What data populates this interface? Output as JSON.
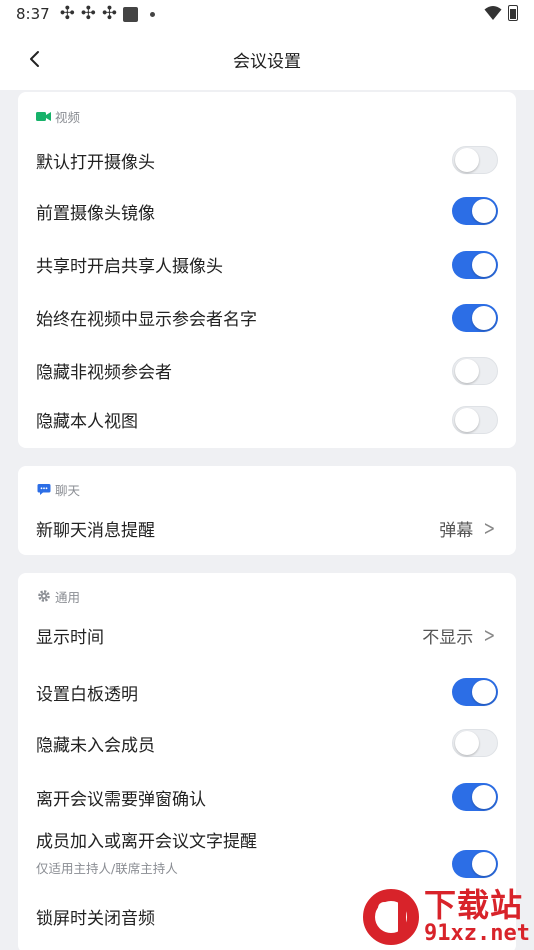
{
  "status_bar": {
    "time": "8:37"
  },
  "header": {
    "title": "会议设置"
  },
  "sections": {
    "video": {
      "title": "视频",
      "items": [
        {
          "label": "默认打开摄像头",
          "on": false
        },
        {
          "label": "前置摄像头镜像",
          "on": true
        },
        {
          "label": "共享时开启共享人摄像头",
          "on": true
        },
        {
          "label": "始终在视频中显示参会者名字",
          "on": true
        },
        {
          "label": "隐藏非视频参会者",
          "on": false
        },
        {
          "label": "隐藏本人视图",
          "on": false
        }
      ]
    },
    "chat": {
      "title": "聊天",
      "items": [
        {
          "label": "新聊天消息提醒",
          "value": "弹幕"
        }
      ]
    },
    "general": {
      "title": "通用",
      "items": [
        {
          "label": "显示时间",
          "value": "不显示"
        },
        {
          "label": "设置白板透明",
          "on": true
        },
        {
          "label": "隐藏未入会成员",
          "on": false
        },
        {
          "label": "离开会议需要弹窗确认",
          "on": true
        },
        {
          "label": "成员加入或离开会议文字提醒",
          "sub": "仅适用主持人/联席主持人",
          "on": true
        },
        {
          "label": "锁屏时关闭音频"
        }
      ]
    }
  },
  "watermark": {
    "brand": "下载站",
    "domain": "91xz.net"
  },
  "colors": {
    "accent": "#2c6ee6",
    "video_icon": "#17b26a",
    "chat_icon": "#2c6ee6",
    "watermark": "#d8232a"
  }
}
